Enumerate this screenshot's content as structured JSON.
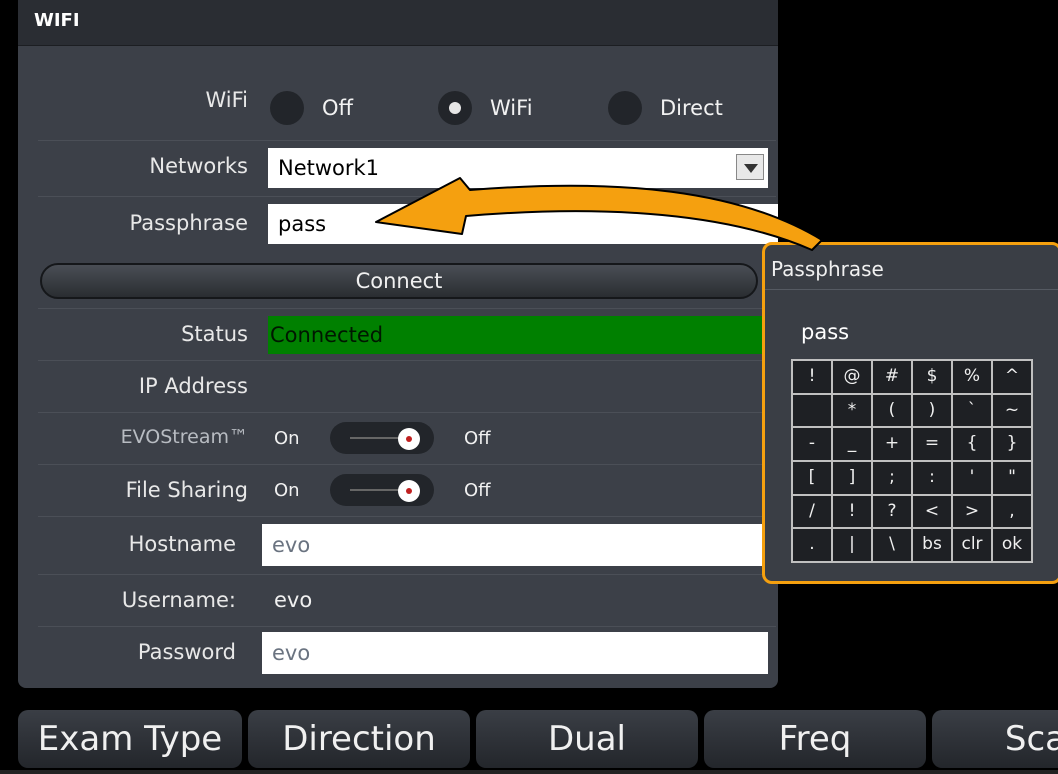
{
  "panel": {
    "title": "WIFI",
    "wifi": {
      "label": "WiFi",
      "options": [
        "Off",
        "WiFi",
        "Direct"
      ],
      "selected": "WiFi"
    },
    "networks": {
      "label": "Networks",
      "value": "Network1"
    },
    "passphrase": {
      "label": "Passphrase",
      "value": "pass"
    },
    "connect_label": "Connect",
    "status": {
      "label": "Status",
      "value": "Connected",
      "color": "#008000"
    },
    "ip_address": {
      "label": "IP Address",
      "value": ""
    },
    "evostream": {
      "label": "EVOStream™",
      "on": "On",
      "off": "Off",
      "state": "off"
    },
    "file_sharing": {
      "label": "File Sharing",
      "on": "On",
      "off": "Off",
      "state": "off"
    },
    "hostname": {
      "label": "Hostname",
      "value": "evo"
    },
    "username": {
      "label": "Username:",
      "value": "evo"
    },
    "password": {
      "label": "Password",
      "value": "evo"
    }
  },
  "keyboard": {
    "title": "Passphrase",
    "value": "pass",
    "keys": [
      [
        "!",
        "@",
        "#",
        "$",
        "%",
        "^"
      ],
      [
        "",
        "*",
        "(",
        ")",
        "`",
        "~"
      ],
      [
        "-",
        "_",
        "+",
        "=",
        "{",
        "}"
      ],
      [
        "[",
        "]",
        ";",
        ":",
        "'",
        "\""
      ],
      [
        "/",
        "!",
        "?",
        "<",
        ">",
        ","
      ],
      [
        ".",
        "|",
        "\\",
        "bs",
        "clr",
        "ok"
      ]
    ],
    "accent_color": "#f5a00f"
  },
  "toolbar": {
    "items": [
      "Exam Type",
      "Direction",
      "Dual",
      "Freq",
      "Sca"
    ]
  }
}
